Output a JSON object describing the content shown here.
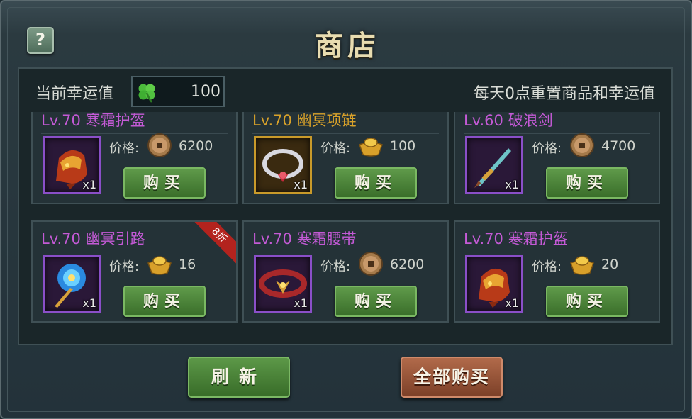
{
  "window": {
    "title": "商店",
    "help_icon": "?"
  },
  "luck": {
    "label": "当前幸运值",
    "value": "100",
    "icon": "clover-icon"
  },
  "reset_note": "每天0点重置商品和幸运值",
  "price_label": "价格:",
  "buy_label": "购买",
  "items": [
    {
      "title": "Lv.70 寒霜护盔",
      "title_color": "#c45ad6",
      "qty": "x1",
      "price": "6200",
      "currency": "copper-coin",
      "frame": "purple",
      "art": "helmet"
    },
    {
      "title": "Lv.70 幽冥项链",
      "title_color": "#d9a22a",
      "qty": "x1",
      "price": "100",
      "currency": "gold-ingot",
      "frame": "gold",
      "art": "necklace"
    },
    {
      "title": "Lv.60 破浪剑",
      "title_color": "#c45ad6",
      "qty": "x1",
      "price": "4700",
      "currency": "copper-coin",
      "frame": "purple",
      "art": "sword"
    },
    {
      "title": "Lv.70 幽冥引路",
      "title_color": "#c45ad6",
      "qty": "x1",
      "price": "16",
      "currency": "gold-ingot",
      "frame": "purple",
      "art": "staff",
      "discount": "8折"
    },
    {
      "title": "Lv.70 寒霜腰带",
      "title_color": "#c45ad6",
      "qty": "x1",
      "price": "6200",
      "currency": "copper-coin",
      "frame": "purple",
      "art": "belt"
    },
    {
      "title": "Lv.70 寒霜护盔",
      "title_color": "#c45ad6",
      "qty": "x1",
      "price": "20",
      "currency": "gold-ingot",
      "frame": "purple",
      "art": "helmet"
    }
  ],
  "buttons": {
    "refresh": "刷新",
    "buy_all": "全部购买"
  },
  "colors": {
    "buy_button": "#4a8a36",
    "buy_all_button": "#9a5538",
    "discount_ribbon": "#b3231e"
  }
}
